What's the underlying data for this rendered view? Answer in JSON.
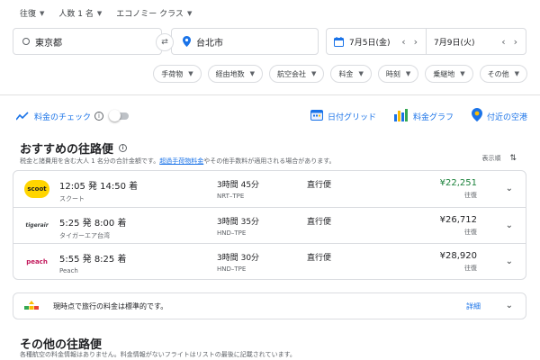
{
  "topbar": {
    "trip_type": "往復",
    "passengers": "人数 1 名",
    "cabin": "エコノミー クラス"
  },
  "search": {
    "origin": "東京都",
    "destination": "台北市",
    "depart_date": "7月5日(金)",
    "return_date": "7月9日(火)"
  },
  "filters": [
    "手荷物",
    "経由地数",
    "航空会社",
    "料金",
    "時刻",
    "乗継地",
    "その他"
  ],
  "tracker": {
    "label": "料金のチェック",
    "tools": [
      "日付グリッド",
      "料金グラフ",
      "付近の空港"
    ]
  },
  "best": {
    "title": "おすすめの往路便",
    "note_prefix": "税金と諸費用を含む大人 1 名分の合計金額です。",
    "note_link": "超過手荷物料金",
    "note_suffix": "やその他手数料が適用される場合があります。",
    "sort_label": "表示順"
  },
  "flights": [
    {
      "logo": "scoot",
      "time": "12:05 発 14:50 着",
      "airline": "スクート",
      "duration": "3時間 45分",
      "route": "NRT–TPE",
      "stops": "直行便",
      "price": "¥22,251",
      "price_type": "往復",
      "low": true
    },
    {
      "logo": "tigerair",
      "time": "5:25 発 8:00 着",
      "airline": "タイガーエア台湾",
      "duration": "3時間 35分",
      "route": "HND–TPE",
      "stops": "直行便",
      "price": "¥26,712",
      "price_type": "往復",
      "low": false
    },
    {
      "logo": "peach",
      "time": "5:55 発 8:25 着",
      "airline": "Peach",
      "duration": "3時間 30分",
      "route": "HND–TPE",
      "stops": "直行便",
      "price": "¥28,920",
      "price_type": "往復",
      "low": false
    }
  ],
  "insight": {
    "text": "現時点で旅行の料金は標準的です。",
    "link": "詳細"
  },
  "other": {
    "title": "その他の往路便",
    "note": "各種航空の料金情報はありません。料金情報がないフライトはリストの最後に記載されています。"
  },
  "colors": {
    "accent": "#1a73e8",
    "low_price": "#188038",
    "scoot": "#ffd500",
    "peach": "#c2185b"
  }
}
